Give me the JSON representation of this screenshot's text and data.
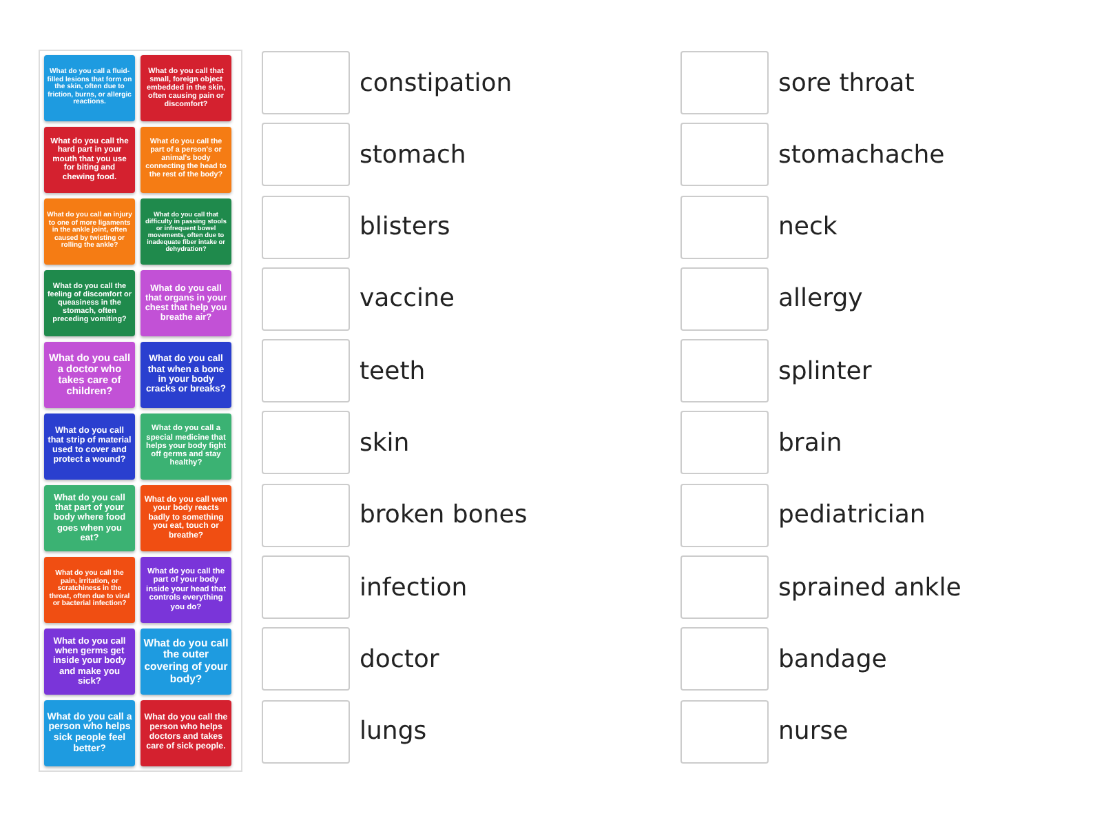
{
  "cards": [
    {
      "text": "What do you call a fluid-filled lesions that form on the skin, often due to friction, burns, or allergic reactions.",
      "color": "#1e9be0"
    },
    {
      "text": "What do you call that small, foreign object embedded in the skin, often causing pain or discomfort?",
      "color": "#d4212f"
    },
    {
      "text": "What do you call the hard part in your mouth that you use for biting and chewing food.",
      "color": "#d4212f"
    },
    {
      "text": "What do you call the part of a person's or animal's body connecting the head to the rest of the body?",
      "color": "#f57c14"
    },
    {
      "text": "What do you call an injury to one of more ligaments in the ankle joint, often caused by twisting or rolling the ankle?",
      "color": "#f57c14"
    },
    {
      "text": "What do you call that difficulty in passing stools or infrequent bowel movements, often due to inadequate fiber intake or dehydration?",
      "color": "#1f8a4c"
    },
    {
      "text": "What do you call the feeling of discomfort or queasiness in the stomach, often preceding vomiting?",
      "color": "#1f8a4c"
    },
    {
      "text": "What do you call that organs in your chest that help you breathe air?",
      "color": "#c251d6"
    },
    {
      "text": "What do you call a doctor who takes care of children?",
      "color": "#c251d6"
    },
    {
      "text": "What do you call that when a bone in your body cracks or breaks?",
      "color": "#2a3fcf"
    },
    {
      "text": "What do you call that strip of material used to cover and protect a wound?",
      "color": "#2a3fcf"
    },
    {
      "text": "What do you call a special medicine that helps your body fight off germs and stay healthy?",
      "color": "#3bb273"
    },
    {
      "text": "What do you call that part of your body where food goes when you eat?",
      "color": "#3bb273"
    },
    {
      "text": "What do you call wen your body reacts badly to something you eat, touch or breathe?",
      "color": "#f04e12"
    },
    {
      "text": "What do you call the pain, irritation, or scratchiness in the throat, often due to viral or bacterial infection?",
      "color": "#f04e12"
    },
    {
      "text": "What do you call the part of your body inside your head that controls everything you do?",
      "color": "#7a35d9"
    },
    {
      "text": "What do you call when germs get inside your body and make you sick?",
      "color": "#7a35d9"
    },
    {
      "text": "What do you call the outer covering of your body?",
      "color": "#1e9be0"
    },
    {
      "text": "What do you call a person who helps sick people feel better?",
      "color": "#1e9be0"
    },
    {
      "text": "What do you call the person who helps doctors and takes care of sick people.",
      "color": "#d4212f"
    }
  ],
  "targets": [
    [
      "constipation",
      "stomach",
      "blisters",
      "vaccine",
      "teeth",
      "skin",
      "broken bones",
      "infection",
      "doctor",
      "lungs"
    ],
    [
      "sore throat",
      "stomachache",
      "neck",
      "allergy",
      "splinter",
      "brain",
      "pediatrician",
      "sprained ankle",
      "bandage",
      "nurse"
    ]
  ]
}
